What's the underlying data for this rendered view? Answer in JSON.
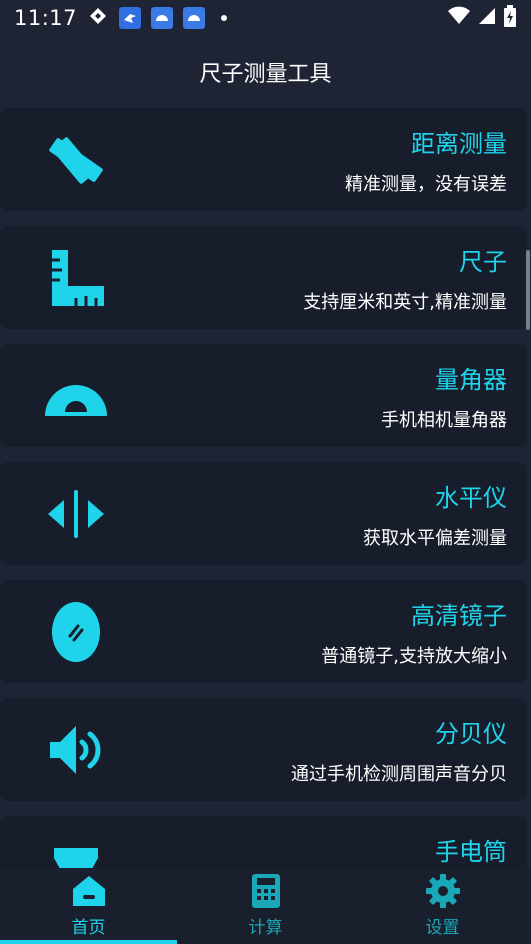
{
  "status_bar": {
    "time": "11:17"
  },
  "header": {
    "title": "尺子测量工具"
  },
  "colors": {
    "accent": "#1fd4ea",
    "background": "#1e2433",
    "card": "#181d2b"
  },
  "cards": [
    {
      "title": "距离测量",
      "subtitle": "精准测量，没有误差",
      "icon": "ruler-pencil-icon"
    },
    {
      "title": "尺子",
      "subtitle": "支持厘米和英寸,精准测量",
      "icon": "ruler-icon"
    },
    {
      "title": "量角器",
      "subtitle": "手机相机量角器",
      "icon": "protractor-icon"
    },
    {
      "title": "水平仪",
      "subtitle": "获取水平偏差测量",
      "icon": "level-icon"
    },
    {
      "title": "高清镜子",
      "subtitle": "普通镜子,支持放大缩小",
      "icon": "mirror-icon"
    },
    {
      "title": "分贝仪",
      "subtitle": "通过手机检测周围声音分贝",
      "icon": "speaker-icon"
    },
    {
      "title": "手电筒",
      "subtitle": "",
      "icon": "flashlight-icon"
    }
  ],
  "nav": {
    "home": "首页",
    "calc": "计算",
    "settings": "设置"
  }
}
